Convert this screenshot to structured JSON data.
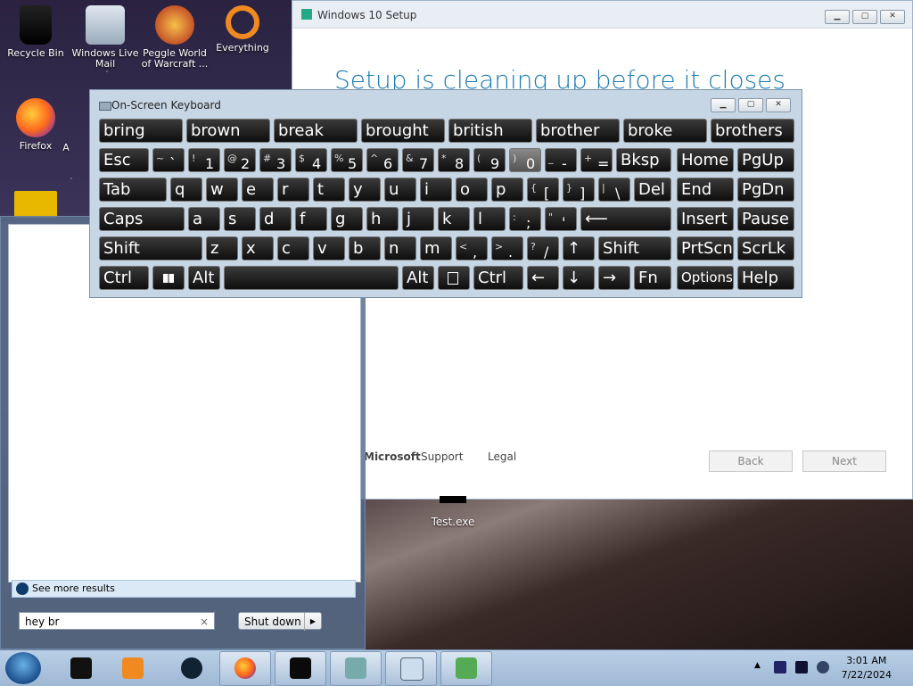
{
  "desktop": {
    "icons": [
      {
        "label": "Recycle Bin"
      },
      {
        "label": "Windows Live Mail"
      },
      {
        "label": "Peggle World of Warcraft ..."
      },
      {
        "label": "Everything"
      },
      {
        "label": "Firefox"
      },
      {
        "label": "A"
      },
      {
        "label": "Test.exe"
      }
    ]
  },
  "setup_window": {
    "title": "Windows 10 Setup",
    "heading": "Setup is cleaning up before it closes",
    "microsoft_label": "Microsoft",
    "support_link": "Support",
    "legal_link": "Legal",
    "back_button": "Back",
    "next_button": "Next"
  },
  "osk": {
    "title": "On-Screen Keyboard",
    "predictions": [
      "bring",
      "brown",
      "break",
      "brought",
      "british",
      "brother",
      "broke",
      "brothers"
    ],
    "row1": {
      "esc": "Esc",
      "tilde": "~",
      "backtick": "`",
      "d1s": "!",
      "d1": "1",
      "d2s": "@",
      "d2": "2",
      "d3s": "#",
      "d3": "3",
      "d4s": "$",
      "d4": "4",
      "d5s": "%",
      "d5": "5",
      "d6s": "^",
      "d6": "6",
      "d7s": "&",
      "d7": "7",
      "d8s": "*",
      "d8": "8",
      "d9s": "(",
      "d9": "9",
      "d0s": ")",
      "d0": "0",
      "minuss": "_",
      "minus": "-",
      "pluss": "+",
      "plus": "=",
      "bksp": "Bksp",
      "home": "Home",
      "pgup": "PgUp"
    },
    "row2": {
      "tab": "Tab",
      "q": "q",
      "w": "w",
      "e": "e",
      "r": "r",
      "t": "t",
      "y": "y",
      "u": "u",
      "i": "i",
      "o": "o",
      "p": "p",
      "lbs": "{",
      "lb": "[",
      "rbs": "}",
      "rb": "]",
      "bss": "|",
      "bs": "\\",
      "del": "Del",
      "end": "End",
      "pgdn": "PgDn"
    },
    "row3": {
      "caps": "Caps",
      "a": "a",
      "s": "s",
      "d": "d",
      "f": "f",
      "g": "g",
      "h": "h",
      "j": "j",
      "k": "k",
      "l": "l",
      "semis": ":",
      "semi": ";",
      "quos": "\"",
      "quo": "'",
      "enter": "⟵",
      "insert": "Insert",
      "pause": "Pause"
    },
    "row4": {
      "shift": "Shift",
      "z": "z",
      "x": "x",
      "c": "c",
      "v": "v",
      "b": "b",
      "n": "n",
      "m": "m",
      "commas": "<",
      "comma": ",",
      "periods": ">",
      "period": ".",
      "slashs": "?",
      "slash": "/",
      "up": "↑",
      "shift_r": "Shift",
      "prtscn": "PrtScn",
      "scrlk": "ScrLk"
    },
    "row5": {
      "ctrl": "Ctrl",
      "alt": "Alt",
      "alt_r": "Alt",
      "ctrl_r": "Ctrl",
      "left": "←",
      "down": "↓",
      "right": "→",
      "fn": "Fn",
      "options": "Options",
      "help": "Help"
    }
  },
  "start_menu": {
    "see_more": "See more results",
    "search_value": "hey br",
    "clear_symbol": "×",
    "shutdown_label": "Shut down",
    "shutdown_arrow": "▶"
  },
  "taskbar": {
    "time": "3:01 AM",
    "date": "7/22/2024",
    "tray_expand": "▲"
  }
}
